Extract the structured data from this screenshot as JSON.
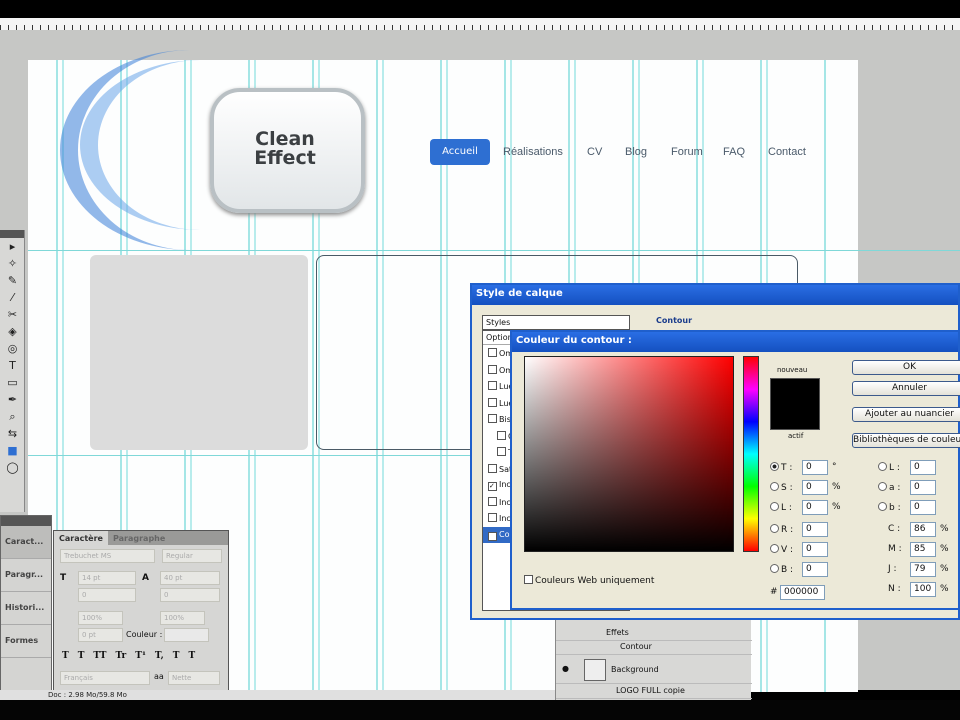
{
  "website": {
    "logo_text_1": "Clean",
    "logo_text_2": "Effect",
    "nav": [
      "Accueil",
      "Réalisations",
      "CV",
      "Blog",
      "Forum",
      "FAQ",
      "Contact"
    ]
  },
  "tools": [
    "move-icon",
    "magic-wand-icon",
    "eyedropper-icon",
    "brush-icon",
    "clone-stamp-icon",
    "paint-bucket-icon",
    "dodge-icon",
    "type-icon",
    "shape-icon",
    "pen-icon",
    "zoom-icon",
    "swap-colors-icon",
    "color-swatch",
    "quick-mask-icon"
  ],
  "tool_glyphs": [
    "▸",
    "✧",
    "✎",
    "⁄",
    "✂",
    "◈",
    "◎",
    "T",
    "▭",
    "✒",
    "⌕",
    "⇆",
    "■",
    "◯"
  ],
  "dock": [
    "Caract...",
    "Paragr...",
    "Histori...",
    "Formes"
  ],
  "character_panel": {
    "tabs": [
      "Caractère",
      "Paragraphe"
    ],
    "font": "Trebuchet MS",
    "style": "Regular",
    "size": "14 pt",
    "leading": "40 pt",
    "kerning": "0",
    "tracking": "0",
    "vscale": "100%",
    "hscale": "100%",
    "baseline": "0 pt",
    "color_label": "Couleur :",
    "style_buttons": [
      "T",
      "T",
      "TT",
      "Tr",
      "T¹",
      "T,",
      "T",
      "T"
    ],
    "language": "Français",
    "aa_label": "aa",
    "antialias": "Nette"
  },
  "status": {
    "doc": "Doc : 2.98 Mo/59.8 Mo"
  },
  "style_dialog": {
    "title": "Style de calque",
    "styles_label": "Styles",
    "options_label": "Options",
    "section": "Contour",
    "items": [
      {
        "label": "Ombre",
        "checked": false
      },
      {
        "label": "Ombre",
        "checked": false
      },
      {
        "label": "Lueur",
        "checked": false
      },
      {
        "label": "Lueur",
        "checked": false
      },
      {
        "label": "Biseau",
        "checked": false
      },
      {
        "label": "C",
        "checked": false
      },
      {
        "label": "T",
        "checked": false
      },
      {
        "label": "Satin",
        "checked": false
      },
      {
        "label": "Incr",
        "checked": true
      },
      {
        "label": "Incr",
        "checked": false
      },
      {
        "label": "Incr",
        "checked": false
      },
      {
        "label": "Contour",
        "checked": true
      }
    ]
  },
  "color_dialog": {
    "title": "Couleur du contour :",
    "new_label": "nouveau",
    "current_label": "actif",
    "new_color": "#000000",
    "buttons": {
      "ok": "OK",
      "cancel": "Annuler",
      "add_swatch": "Ajouter au nuancier",
      "libraries": "Bibliothèques de couleurs"
    },
    "web_only": "Couleurs Web uniquement",
    "hsb": [
      {
        "k": "T :",
        "v": "0",
        "u": "°",
        "sel": true
      },
      {
        "k": "S :",
        "v": "0",
        "u": "%"
      },
      {
        "k": "L :",
        "v": "0",
        "u": "%"
      }
    ],
    "rgb": [
      {
        "k": "R :",
        "v": "0"
      },
      {
        "k": "V :",
        "v": "0"
      },
      {
        "k": "B :",
        "v": "0"
      }
    ],
    "lab": [
      {
        "k": "L :",
        "v": "0"
      },
      {
        "k": "a :",
        "v": "0"
      },
      {
        "k": "b :",
        "v": "0"
      }
    ],
    "cmyk": [
      {
        "k": "C :",
        "v": "86",
        "u": "%"
      },
      {
        "k": "M :",
        "v": "85",
        "u": "%"
      },
      {
        "k": "J :",
        "v": "79",
        "u": "%"
      },
      {
        "k": "N :",
        "v": "100",
        "u": "%"
      }
    ],
    "hex_label": "#",
    "hex": "000000"
  },
  "layers": {
    "effects": "Effets",
    "stroke": "Contour",
    "background": "Background",
    "group": "LOGO FULL copie"
  }
}
